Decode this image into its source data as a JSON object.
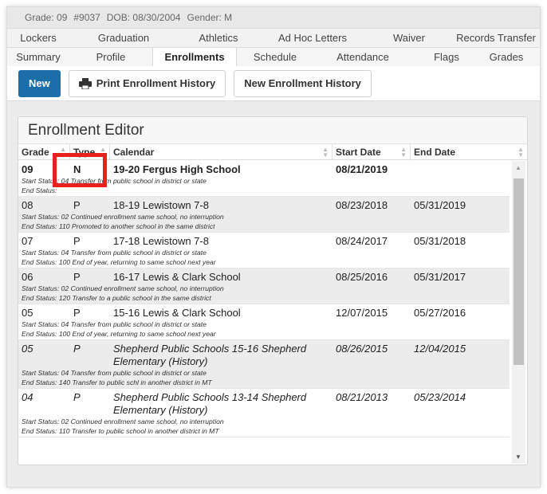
{
  "info": {
    "grade": "Grade: 09",
    "student_id": "#9037",
    "dob": "DOB: 08/30/2004",
    "gender": "Gender: M"
  },
  "tabs_row1": [
    "Lockers",
    "Graduation",
    "Athletics",
    "Ad Hoc Letters",
    "Waiver",
    "Records Transfer"
  ],
  "tabs_row2": [
    "Summary",
    "Profile",
    "Enrollments",
    "Schedule",
    "Attendance",
    "Flags",
    "Grades"
  ],
  "toolbar": {
    "new_label": "New",
    "print_label": "Print Enrollment History",
    "new_history_label": "New Enrollment History"
  },
  "editor": {
    "title": "Enrollment Editor",
    "columns": [
      "Grade",
      "Type",
      "Calendar",
      "Start Date",
      "End Date"
    ]
  },
  "rows": [
    {
      "grade": "09",
      "type": "N",
      "calendar": "19-20 Fergus High School",
      "start": "08/21/2019",
      "end": "",
      "start_status": "Start Status: 04 Transfer from public school in district or state",
      "end_status": "End Status:"
    },
    {
      "grade": "08",
      "type": "P",
      "calendar": "18-19 Lewistown 7-8",
      "start": "08/23/2018",
      "end": "05/31/2019",
      "start_status": "Start Status: 02 Continued enrollment same school, no interruption",
      "end_status": "End Status: 110 Promoted to another school in the same district"
    },
    {
      "grade": "07",
      "type": "P",
      "calendar": "17-18 Lewistown 7-8",
      "start": "08/24/2017",
      "end": "05/31/2018",
      "start_status": "Start Status: 04 Transfer from public school in district or state",
      "end_status": "End Status: 100 End of year, returning to same school next year"
    },
    {
      "grade": "06",
      "type": "P",
      "calendar": "16-17 Lewis & Clark School",
      "start": "08/25/2016",
      "end": "05/31/2017",
      "start_status": "Start Status: 02 Continued enrollment same school, no interruption",
      "end_status": "End Status: 120 Transfer to a public school in the same district"
    },
    {
      "grade": "05",
      "type": "P",
      "calendar": "15-16 Lewis & Clark School",
      "start": "12/07/2015",
      "end": "05/27/2016",
      "start_status": "Start Status: 04 Transfer from public school in district or state",
      "end_status": "End Status: 100 End of year, returning to same school next year"
    },
    {
      "grade": "05",
      "type": "P",
      "calendar": "Shepherd Public Schools 15-16 Shepherd Elementary (History)",
      "start": "08/26/2015",
      "end": "12/04/2015",
      "start_status": "Start Status: 04 Transfer from public school in district or state",
      "end_status": "End Status: 140 Transfer to public schl in another district in MT"
    },
    {
      "grade": "04",
      "type": "P",
      "calendar": "Shepherd Public Schools 13-14 Shepherd Elementary (History)",
      "start": "08/21/2013",
      "end": "05/23/2014",
      "start_status": "Start Status: 02 Continued enrollment same school, no interruption",
      "end_status": "End Status: 110 Transfer to public school in another district in MT"
    }
  ],
  "colors": {
    "accent": "#1b6ea8",
    "highlight": "#e8201e"
  }
}
